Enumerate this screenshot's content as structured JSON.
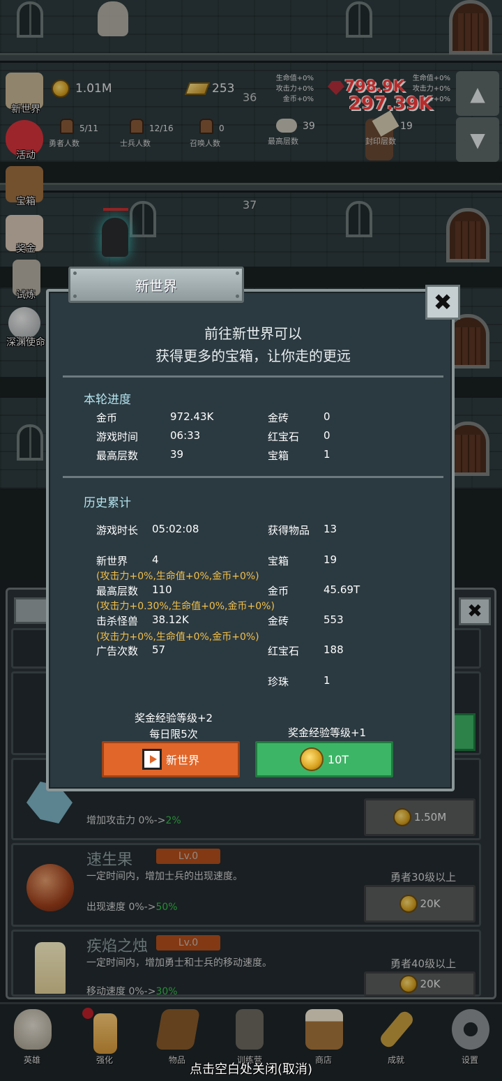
{
  "hud": {
    "gold": "1.01M",
    "gold_bars": "253",
    "hero_count": "5/11",
    "hero_count_label": "勇者人数",
    "soldier_count": "12/16",
    "soldier_count_label": "士兵人数",
    "summon_count": "0",
    "summon_count_label": "召唤人数",
    "max_floor": "39",
    "max_floor_label": "最高层数",
    "seal_floor": "19",
    "seal_floor_label": "封印层数",
    "bonus_left": [
      "生命值+0%",
      "攻击力+0%",
      "金币+0%"
    ],
    "bonus_right": [
      "生命值+0%",
      "攻击力+0%",
      "金币+0%"
    ],
    "damage_a": "798.9K",
    "damage_b": "297.39K"
  },
  "floors": [
    "36",
    "37"
  ],
  "side_menu": [
    {
      "label": "新世界",
      "icon": "map-icon"
    },
    {
      "label": "活动",
      "icon": "heart-icon"
    },
    {
      "label": "宝箱",
      "icon": "chest-icon"
    },
    {
      "label": "奖金",
      "icon": "envelope-icon"
    },
    {
      "label": "试炼",
      "icon": "quill-icon"
    },
    {
      "label": "深渊使命",
      "icon": "orb-icon"
    }
  ],
  "dialog": {
    "title": "新世界",
    "close_glyph": "✖",
    "headline_1": "前往新世界可以",
    "headline_2": "获得更多的宝箱，让你走的更远",
    "round_title": "本轮进度",
    "round": {
      "gold_label": "金币",
      "gold": "972.43K",
      "bricks_label": "金砖",
      "bricks": "0",
      "time_label": "游戏时间",
      "time": "06:33",
      "ruby_label": "红宝石",
      "ruby": "0",
      "floor_label": "最高层数",
      "floor": "39",
      "chest_label": "宝箱",
      "chest": "1"
    },
    "history_title": "历史累计",
    "history": {
      "duration_label": "游戏时长",
      "duration": "05:02:08",
      "items_label": "获得物品",
      "items": "13",
      "newworld_label": "新世界",
      "newworld": "4",
      "chest_label": "宝箱",
      "chest": "19",
      "newworld_buff": "(攻击力+0%,生命值+0%,金币+0%)",
      "floor_label": "最高层数",
      "floor": "110",
      "gold_label": "金币",
      "gold": "45.69T",
      "floor_buff": "(攻击力+0.30%,生命值+0%,金币+0%)",
      "kills_label": "击杀怪兽",
      "kills": "38.12K",
      "bricks_label": "金砖",
      "bricks": "553",
      "kills_buff": "(攻击力+0%,生命值+0%,金币+0%)",
      "ads_label": "广告次数",
      "ads": "57",
      "ruby_label": "红宝石",
      "ruby": "188",
      "pearl_label": "珍珠",
      "pearl": "1"
    },
    "ad_note_1": "奖金经验等级+2",
    "ad_note_2": "每日限5次",
    "ad_button": "新世界",
    "gold_note": "奖金经验等级+1",
    "gold_button": "10T"
  },
  "lower_panel": {
    "close_glyph": "✖",
    "card_attack": {
      "stat": "增加攻击力 0%->",
      "stat_new": "2%",
      "button": "1.50M"
    },
    "card_speed": {
      "name": "速生果",
      "level": "Lv.0",
      "desc": "一定时间内，增加士兵的出现速度。",
      "stat": "出现速度 0%->",
      "stat_new": "50%",
      "req": "勇者30级以上",
      "button": "20K"
    },
    "card_candle": {
      "name": "疾焰之烛",
      "level": "Lv.0",
      "desc": "一定时间内，增加勇士和士兵的移动速度。",
      "stat": "移动速度 0%->",
      "stat_new": "30%",
      "req": "勇者40级以上",
      "button": "20K"
    }
  },
  "nav": [
    {
      "label": "英雄",
      "icon": "skull-icon"
    },
    {
      "label": "强化",
      "icon": "candle-icon"
    },
    {
      "label": "物品",
      "icon": "book-icon"
    },
    {
      "label": "训练营",
      "icon": "lantern-icon"
    },
    {
      "label": "商店",
      "icon": "mug-icon"
    },
    {
      "label": "成就",
      "icon": "key-icon"
    },
    {
      "label": "设置",
      "icon": "gear-icon"
    }
  ],
  "close_hint": "点击空白处关闭(取消)"
}
